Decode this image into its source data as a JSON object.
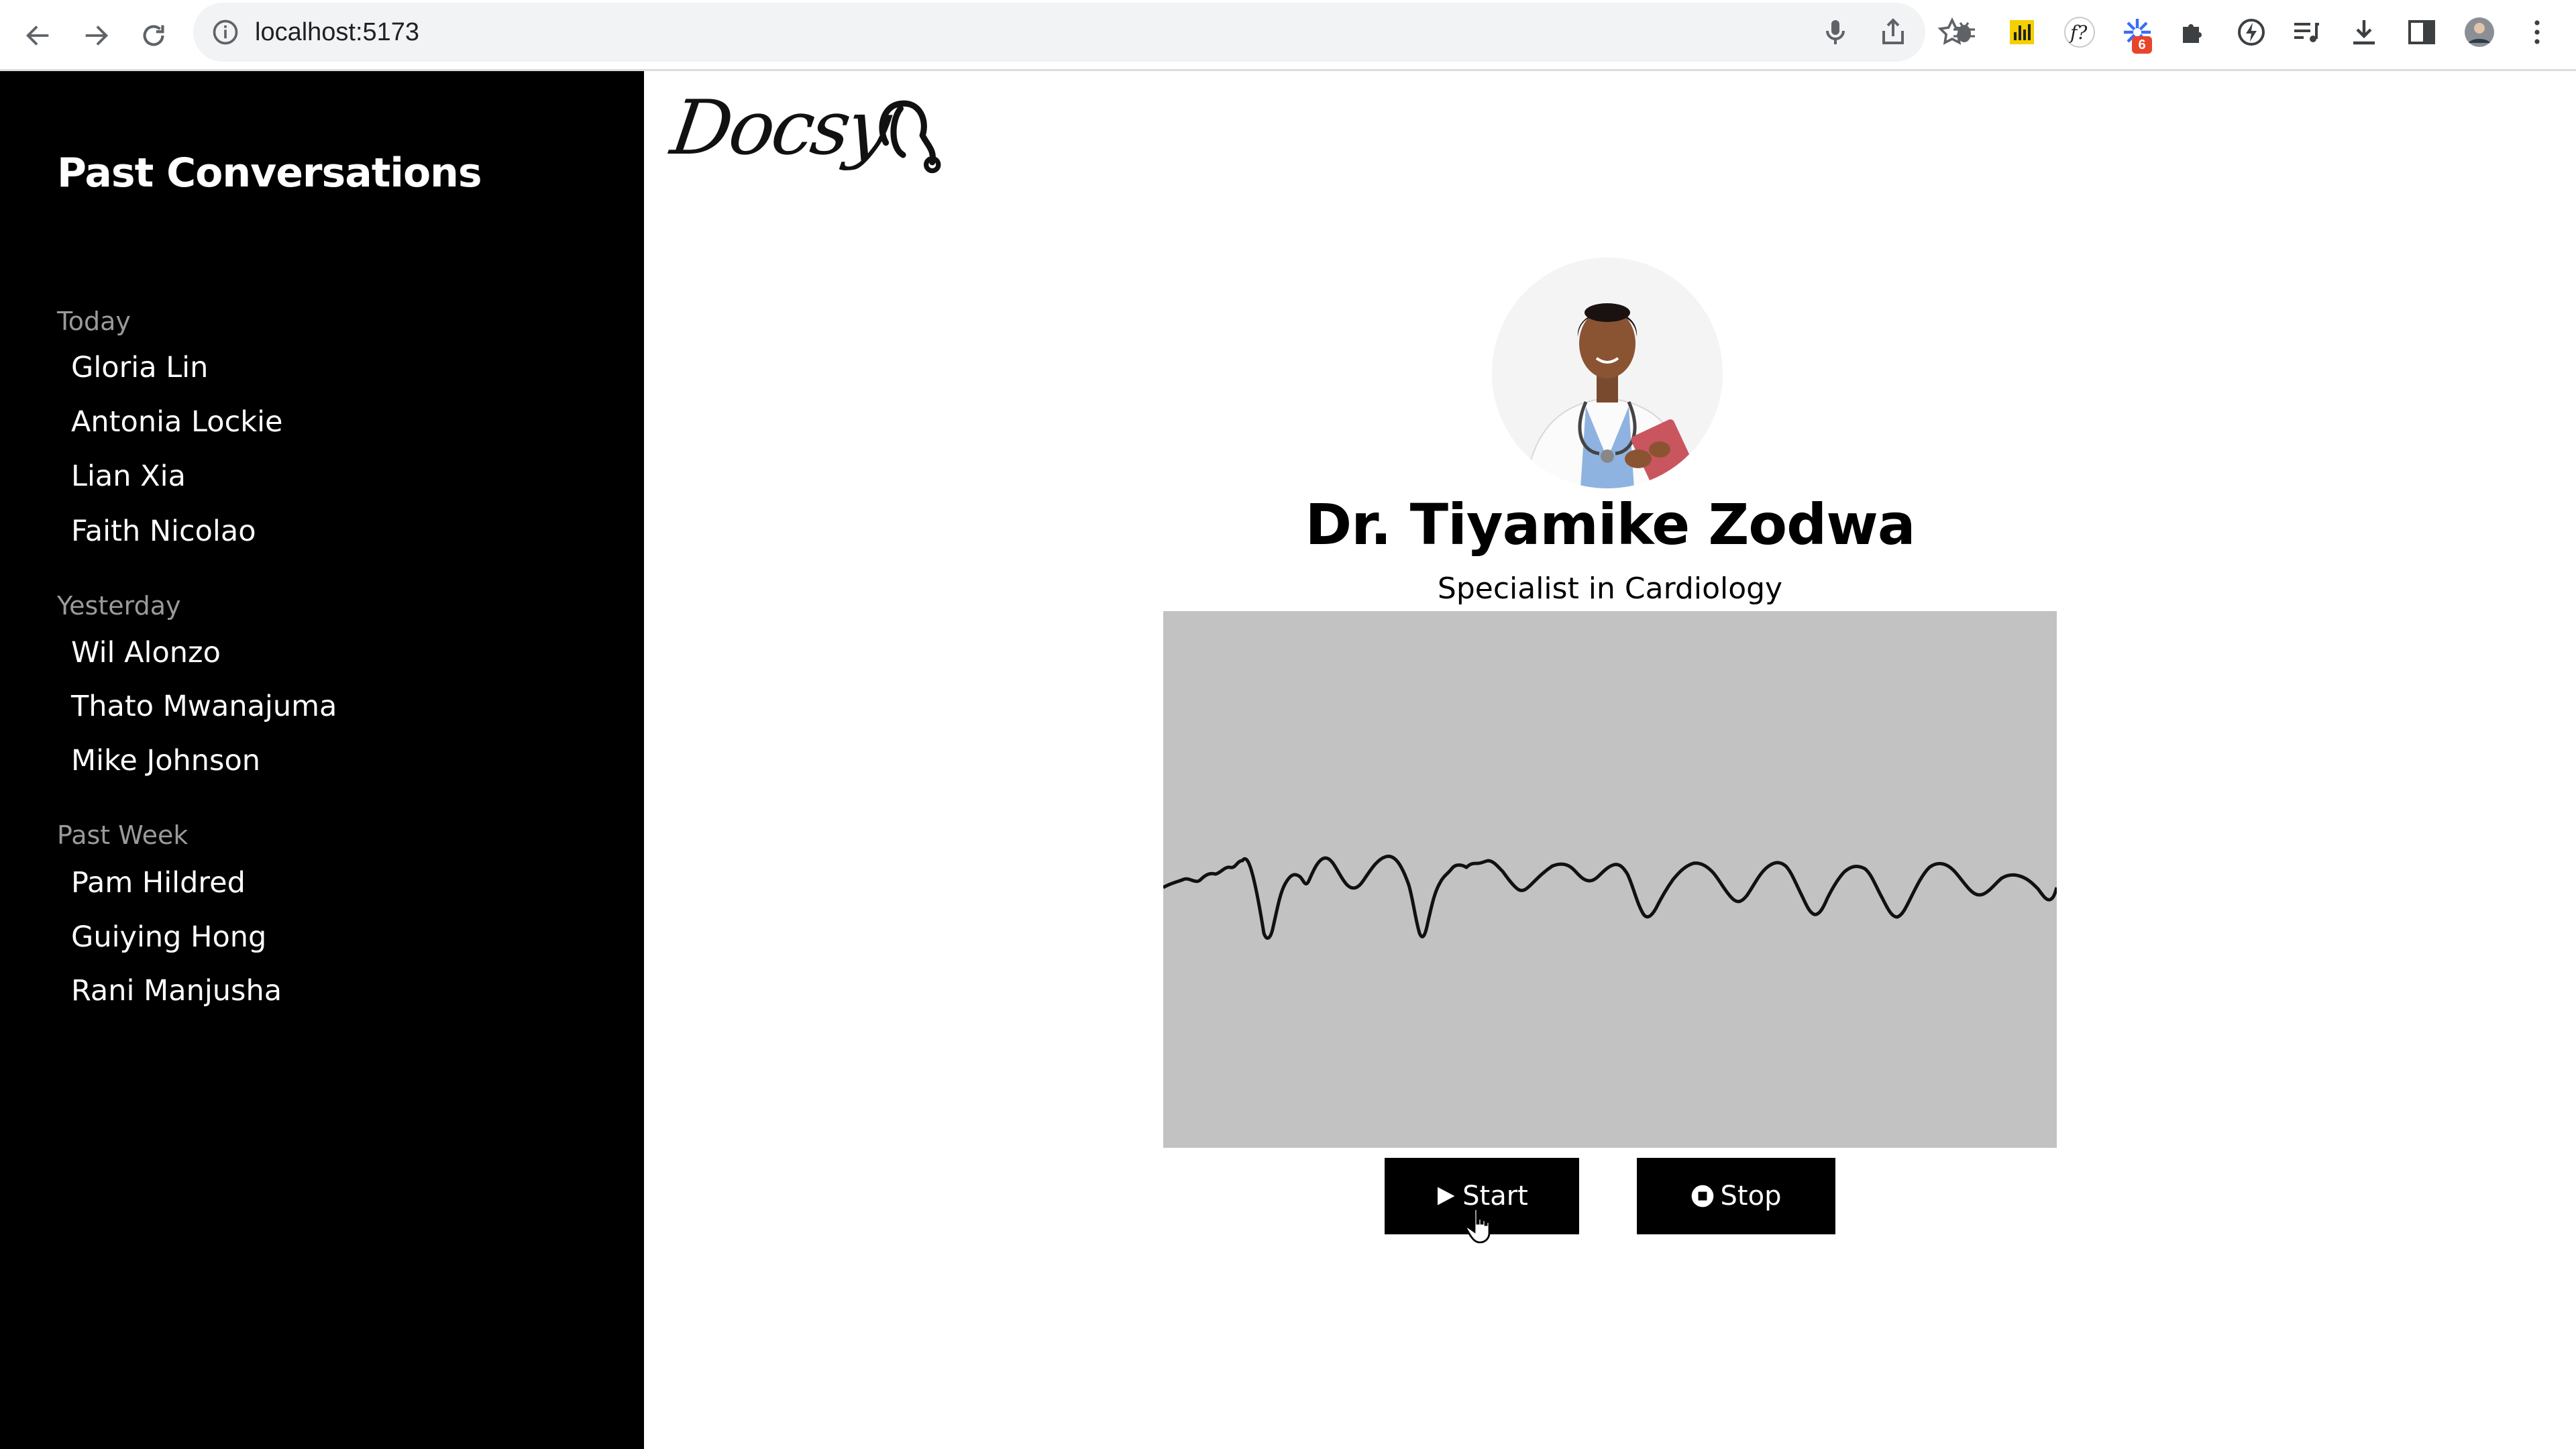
{
  "browser": {
    "url": "localhost:5173",
    "extension_badge": "6"
  },
  "sidebar": {
    "title": "Past Conversations",
    "groups": [
      {
        "label": "Today",
        "items": [
          "Gloria Lin",
          "Antonia Lockie",
          "Lian Xia",
          "Faith Nicolao"
        ]
      },
      {
        "label": "Yesterday",
        "items": [
          "Wil Alonzo",
          "Thato Mwanajuma",
          "Mike Johnson"
        ]
      },
      {
        "label": "Past Week",
        "items": [
          "Pam Hildred",
          "Guiying Hong",
          "Rani Manjusha"
        ]
      }
    ]
  },
  "brand": {
    "logo_text": "Docsy"
  },
  "doctor": {
    "name": "Dr. Tiyamike Zodwa",
    "specialty": "Specialist in Cardiology"
  },
  "controls": {
    "start_label": "Start",
    "stop_label": "Stop"
  },
  "colors": {
    "sidebar_bg": "#000000",
    "wave_panel_bg": "#c2c2c2",
    "button_bg": "#000000",
    "muted_label": "#9a9a9a"
  },
  "icons": [
    "back-arrow-icon",
    "forward-arrow-icon",
    "reload-icon",
    "info-icon",
    "microphone-icon",
    "share-icon",
    "bookmark-star-icon",
    "bug-icon",
    "bar-chart-icon",
    "font-question-icon",
    "spark-icon",
    "puzzle-icon",
    "lightning-icon",
    "playlist-icon",
    "download-icon",
    "sidebar-toggle-icon",
    "profile-avatar",
    "kebab-menu-icon",
    "stethoscope-icon",
    "play-icon",
    "stop-circle-icon"
  ]
}
